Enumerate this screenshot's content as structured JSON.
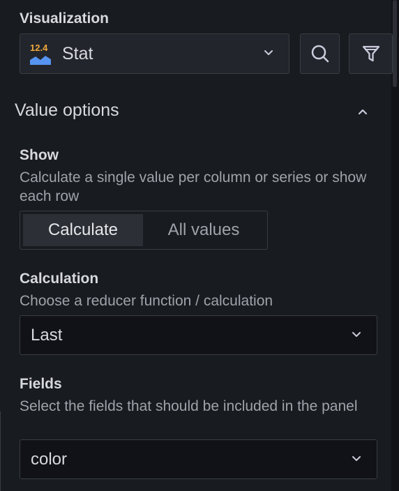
{
  "visualization": {
    "label": "Visualization",
    "selected": "Stat",
    "icon_number": "12.4",
    "icon": "stat-chart-icon",
    "search_icon": "search-icon",
    "filter_icon": "filter-icon"
  },
  "value_options": {
    "title": "Value options",
    "collapse_icon": "chevron-up-icon",
    "show": {
      "label": "Show",
      "description": "Calculate a single value per column or series or show each row",
      "options": [
        "Calculate",
        "All values"
      ],
      "selected": "Calculate"
    },
    "calculation": {
      "label": "Calculation",
      "description": "Choose a reducer function / calculation",
      "value": "Last"
    },
    "fields": {
      "label": "Fields",
      "description": "Select the fields that should be included in the panel",
      "value": "color"
    }
  },
  "colors": {
    "background": "#181b1f",
    "input_bg": "#111217",
    "border": "#3a3d43",
    "icon_orange": "#f2a93b",
    "icon_blue": "#5794f2"
  }
}
